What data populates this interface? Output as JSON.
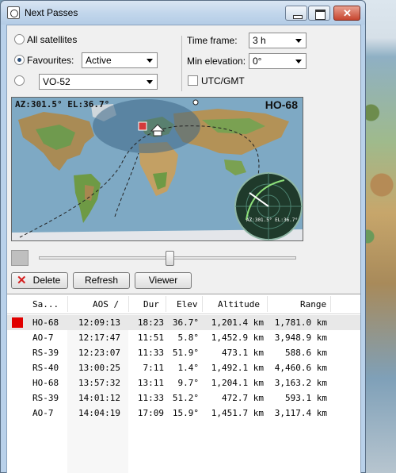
{
  "window": {
    "title": "Next Passes"
  },
  "options": {
    "all_satellites_label": "All satellites",
    "favourites_label": "Favourites:",
    "favourites_value": "Active",
    "single_sat_value": "VO-52",
    "selected_radio": "favourites",
    "time_frame_label": "Time frame:",
    "time_frame_value": "3 h",
    "min_elevation_label": "Min elevation:",
    "min_elevation_value": "0°",
    "utc_label": "UTC/GMT",
    "utc_checked": false
  },
  "map": {
    "readout": "AZ:301.5°  EL:36.7°",
    "satellite": "HO-68",
    "radar_readout": "AZ:301.5°  EL:36.7°"
  },
  "slider": {
    "position_fraction": 0.51
  },
  "buttons": {
    "delete": "Delete",
    "refresh": "Refresh",
    "viewer": "Viewer"
  },
  "table": {
    "headers": [
      "Sa...",
      "AOS /",
      "Dur",
      "Elev",
      "Altitude",
      "Range"
    ],
    "rows": [
      {
        "sat": "HO-68",
        "aos": "12:09:13",
        "dur": "18:23",
        "elev": "36.7°",
        "alt": "1,201.4 km",
        "range": "1,781.0 km",
        "marked": true
      },
      {
        "sat": "AO-7",
        "aos": "12:17:47",
        "dur": "11:51",
        "elev": "5.8°",
        "alt": "1,452.9 km",
        "range": "3,948.9 km",
        "marked": false
      },
      {
        "sat": "RS-39",
        "aos": "12:23:07",
        "dur": "11:33",
        "elev": "51.9°",
        "alt": "473.1 km",
        "range": "588.6 km",
        "marked": false
      },
      {
        "sat": "RS-40",
        "aos": "13:00:25",
        "dur": "7:11",
        "elev": "1.4°",
        "alt": "1,492.1 km",
        "range": "4,460.6 km",
        "marked": false
      },
      {
        "sat": "HO-68",
        "aos": "13:57:32",
        "dur": "13:11",
        "elev": "9.7°",
        "alt": "1,204.1 km",
        "range": "3,163.2 km",
        "marked": false
      },
      {
        "sat": "RS-39",
        "aos": "14:01:12",
        "dur": "11:33",
        "elev": "51.2°",
        "alt": "472.7 km",
        "range": "593.1 km",
        "marked": false
      },
      {
        "sat": "AO-7",
        "aos": "14:04:19",
        "dur": "17:09",
        "elev": "15.9°",
        "alt": "1,451.7 km",
        "range": "3,117.4 km",
        "marked": false
      }
    ]
  }
}
